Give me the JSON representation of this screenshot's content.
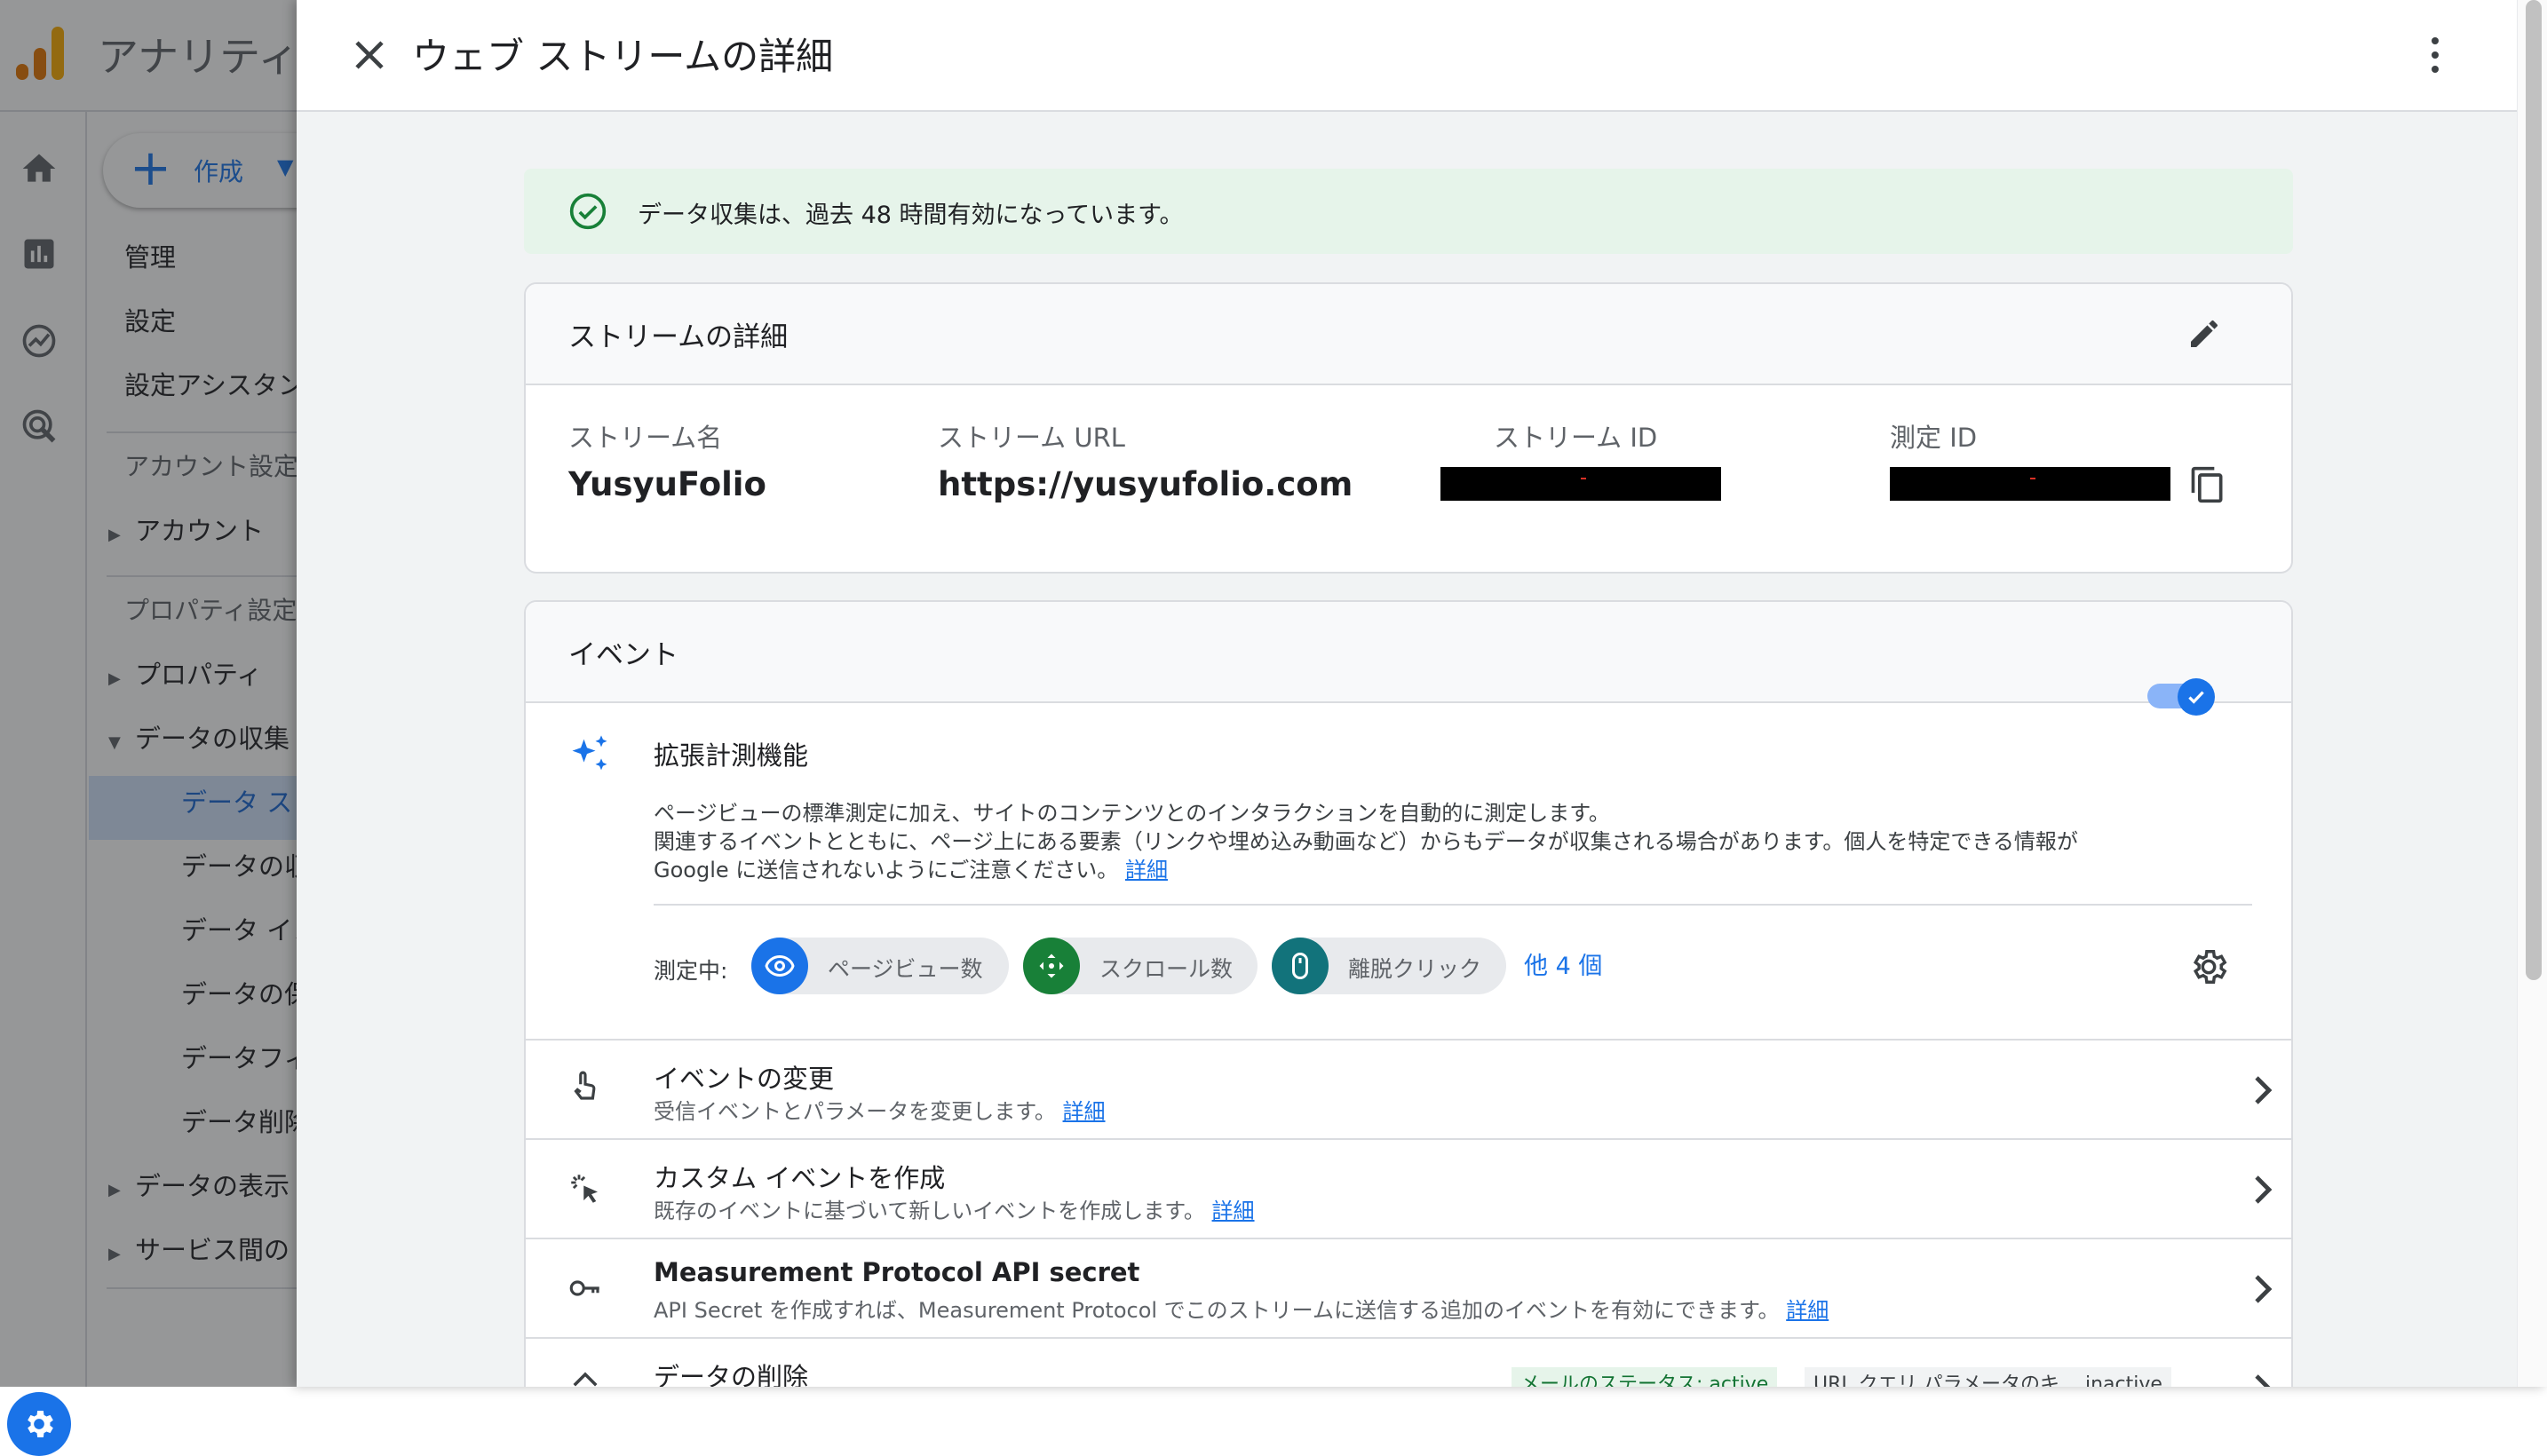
{
  "background": {
    "app_title": "アナリティ",
    "create_button": "作成",
    "nav": {
      "admin": "管理",
      "settings": "設定",
      "setup_assistant": "設定アシスタン",
      "account_settings_header": "アカウント設定",
      "account": "アカウント",
      "property_settings_header": "プロパティ設定",
      "property": "プロパティ",
      "data_collection": "データの収集",
      "data_streams": "データ スト",
      "data_collection_sub": "データの収",
      "data_import": "データ イン",
      "data_retention": "データの保",
      "data_filters": "データフィ",
      "data_deletion": "データ削除",
      "data_display": "データの表示",
      "service_links": "サービス間の"
    }
  },
  "drawer": {
    "title": "ウェブ ストリームの詳細",
    "status_message": "データ収集は、過去 48 時間有効になっています。",
    "stream_details": {
      "heading": "ストリームの詳細",
      "fields": [
        {
          "label": "ストリーム名",
          "value": "YusyuFolio"
        },
        {
          "label": "ストリーム URL",
          "value": "https://yusyufolio.com"
        },
        {
          "label": "ストリーム ID",
          "value": ""
        },
        {
          "label": "測定 ID",
          "value": ""
        }
      ]
    },
    "events": {
      "heading": "イベント",
      "enhanced": {
        "title": "拡張計測機能",
        "desc_line1": "ページビューの標準測定に加え、サイトのコンテンツとのインタラクションを自動的に測定します。",
        "desc_line2": "関連するイベントとともに、ページ上にある要素（リンクや埋め込み動画など）からもデータが収集される場合があります。個人を特定できる情報が",
        "desc_line3": "Google に送信されないようにご注意ください。",
        "learn_more": "詳細",
        "toggle_on": true,
        "measuring_label": "測定中:",
        "chips": [
          "ページビュー数",
          "スクロール数",
          "離脱クリック"
        ],
        "more": "他 4 個"
      },
      "rows": [
        {
          "title": "イベントの変更",
          "desc": "受信イベントとパラメータを変更します。",
          "link": "詳細"
        },
        {
          "title": "カスタム イベントを作成",
          "desc": "既存のイベントに基づいて新しいイベントを作成します。",
          "link": "詳細"
        },
        {
          "title": "Measurement Protocol API secret",
          "desc": "API Secret を作成すれば、Measurement Protocol でこのストリームに送信する追加のイベントを有効にできます。",
          "link": "詳細"
        },
        {
          "title": "データの削除",
          "tag1": "メールのステータス: active",
          "tag2": "URL クエリ パラメータのキ… inactive"
        }
      ]
    }
  },
  "colors": {
    "accent": "#1a73e8",
    "success_bg": "#e6f4ea",
    "success_icon": "#188038",
    "chip_scroll": "#188038",
    "chip_click": "#12737b"
  }
}
